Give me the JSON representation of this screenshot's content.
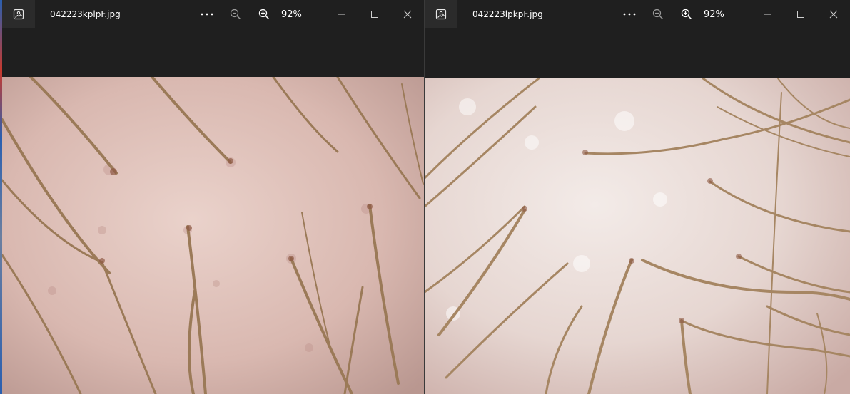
{
  "windows": [
    {
      "filename": "042223kplpF.jpg",
      "zoom": "92%",
      "image": {
        "skin_tone": "#dcbdb6",
        "hair_color": "#9b7a58"
      }
    },
    {
      "filename": "042223lpkpF.jpg",
      "zoom": "92%",
      "image": {
        "skin_tone": "#e9dcd8",
        "hair_color": "#a68663"
      }
    }
  ],
  "colors": {
    "titlebar_bg": "#1f1f1f",
    "icon_button_bg": "#2b2b2b",
    "text": "#ffffff"
  },
  "icons": [
    "gallery-icon",
    "more-icon",
    "zoom-out-icon",
    "zoom-in-icon",
    "minimize-icon",
    "maximize-icon",
    "close-icon"
  ]
}
